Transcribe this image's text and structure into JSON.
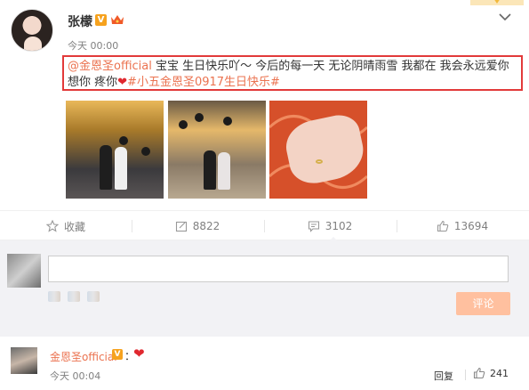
{
  "post": {
    "author": "张檬",
    "verified_badge": "V",
    "time": "今天 00:00",
    "text": {
      "mention": "@金恩圣official",
      "body": " 宝宝  生日快乐吖～  今后的每一天 无论阴晴雨雪  我都在 我会永远爱你 想你 疼你",
      "hashtag": "#小五金恩圣0917生日快乐#"
    }
  },
  "actions": {
    "favorite": "收藏",
    "repost": "8822",
    "comment": "3102",
    "like": "13694"
  },
  "comment_box": {
    "submit": "评论"
  },
  "reply": {
    "author": "金恩圣official",
    "verified_badge": "V",
    "colon": "：",
    "time": "今天 00:04",
    "reply_label": "回复",
    "likes": "241"
  },
  "colors": {
    "link": "#eb7350",
    "highlight_border": "#e23a3a",
    "submit_bg": "#ffc09f",
    "verified": "#f6a21e"
  }
}
